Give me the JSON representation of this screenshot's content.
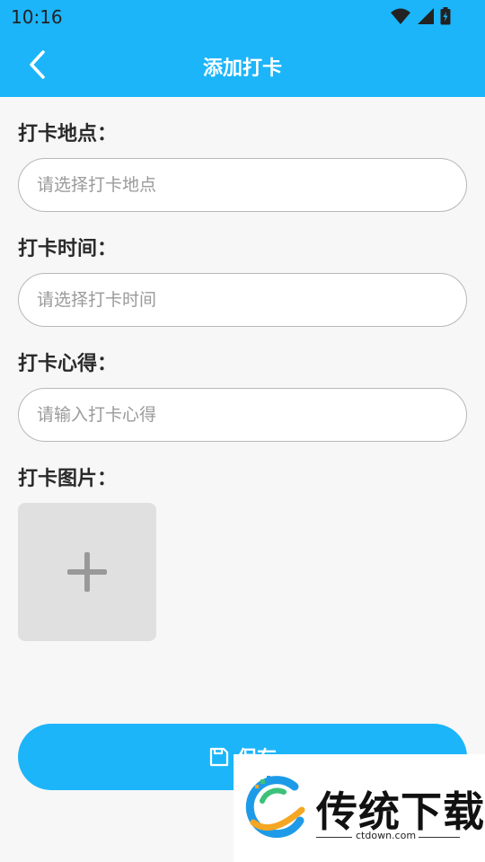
{
  "status_bar": {
    "time": "10:16",
    "icons": [
      "wifi-icon",
      "signal-icon",
      "battery-icon"
    ]
  },
  "app_bar": {
    "title": "添加打卡",
    "back_icon": "chevron-left-icon"
  },
  "form": {
    "location": {
      "label": "打卡地点：",
      "placeholder": "请选择打卡地点",
      "value": ""
    },
    "time": {
      "label": "打卡时间：",
      "placeholder": "请选择打卡时间",
      "value": ""
    },
    "notes": {
      "label": "打卡心得：",
      "placeholder": "请输入打卡心得",
      "value": ""
    },
    "image": {
      "label": "打卡图片：",
      "add_icon": "plus-icon"
    }
  },
  "save": {
    "label": "保存",
    "icon": "save-icon"
  },
  "watermark": {
    "title": "传统下载",
    "url": "ctdown.com"
  },
  "colors": {
    "accent": "#1cb5fa",
    "background": "#f7f7f7",
    "placeholder": "#9a9a9a",
    "image_bg": "#e0e0e0"
  }
}
